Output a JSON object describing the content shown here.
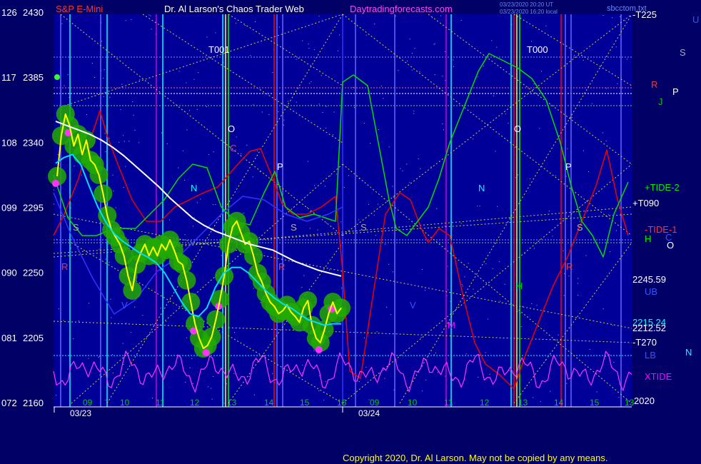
{
  "header": {
    "left_title": "S&P E-Mini",
    "center_title": "Dr. Al Larson's Chaos Trader Web",
    "site": "Daytradingforecasts.com",
    "timestamp_1": "03/23/2020 20:20 UT",
    "timestamp_2": "03/23/2020 16:20 local",
    "right_note": "sbcctom.txt"
  },
  "footer": {
    "copyright": "Copyright 2020, Dr. Al Larson. May not be copied by any means."
  },
  "colors": {
    "background": "#000066",
    "plot_bg": "#000099",
    "price_yellow": "#ffff00",
    "green_bubbles": "#22bb00",
    "magenta": "#ff00ff",
    "cyan": "#00ffff",
    "white": "#ffffff",
    "red": "#ff0000",
    "green_line": "#00ee00",
    "blue": "#3333ff"
  },
  "chart_data": {
    "type": "line",
    "title": "S&P E-Mini",
    "y_axis_left": {
      "ticks": [
        {
          "left": "126",
          "right": "2430"
        },
        {
          "left": "117",
          "right": "2385"
        },
        {
          "left": "108",
          "right": "2340"
        },
        {
          "left": "099",
          "right": "2295"
        },
        {
          "left": "090",
          "right": "2250"
        },
        {
          "left": "081",
          "right": "2205"
        },
        {
          "left": "072",
          "right": "2160"
        }
      ],
      "ylim": [
        2160,
        2430
      ]
    },
    "x_axis": {
      "hour_labels": [
        "09",
        "10",
        "11",
        "12",
        "13",
        "14",
        "15",
        "16",
        "09",
        "10",
        "11",
        "12",
        "13",
        "14",
        "15",
        "13"
      ],
      "date_labels": [
        "03/23",
        "03/24"
      ]
    },
    "right_labels": {
      "t225": "-T225",
      "tide2": "+TIDE-2",
      "t090": "+T090",
      "tide1": "-TIDE-1",
      "h": "H",
      "c": "C",
      "o": "O",
      "v1": "2245.59",
      "ub": "UB",
      "v2": "2215.24",
      "v3": "2212.52",
      "t270": "-T270",
      "lb": "LB",
      "n": "N",
      "xtide": "XTIDE",
      "v4": "2020",
      "u": "U",
      "s": "S",
      "r": "R",
      "p": "P",
      "j": "J"
    },
    "chart_letters": {
      "t001": "T001",
      "t000": "T000",
      "o": "O",
      "c": "C",
      "p": "P",
      "n": "N",
      "s": "S",
      "r": "R",
      "v": "V",
      "m": "M",
      "h": "H"
    },
    "price_series": {
      "name": "price",
      "values": [
        2317,
        2345,
        2360,
        2352,
        2338,
        2346,
        2332,
        2342,
        2328,
        2325,
        2318,
        2305,
        2290,
        2280,
        2275,
        2270,
        2262,
        2248,
        2238,
        2256,
        2264,
        2270,
        2262,
        2268,
        2262,
        2270,
        2266,
        2273,
        2266,
        2258,
        2256,
        2245,
        2230,
        2215,
        2205,
        2198,
        2200,
        2206,
        2218,
        2232,
        2248,
        2270,
        2282,
        2286,
        2278,
        2270,
        2272,
        2262,
        2250,
        2244,
        2236,
        2230,
        2227,
        2222,
        2224,
        2228,
        2223,
        2220,
        2216,
        2226,
        2231,
        2214,
        2205,
        2202,
        2211,
        2222,
        2230,
        2222,
        2226
      ]
    },
    "ma_white": [
      2355,
      2352,
      2349,
      2346,
      2342,
      2337,
      2331,
      2324,
      2317,
      2310,
      2302,
      2295,
      2288,
      2283,
      2279,
      2276,
      2273,
      2270,
      2268,
      2266,
      2262,
      2258,
      2255,
      2252,
      2250,
      2248
    ],
    "ma_cyan": [
      2326,
      2330,
      2332,
      2325,
      2310,
      2296,
      2285,
      2277,
      2272,
      2268,
      2264,
      2261,
      2257,
      2250,
      2240,
      2230,
      2222,
      2220,
      2226,
      2240,
      2250,
      2254,
      2254,
      2250,
      2244,
      2238,
      2233,
      2229,
      2226,
      2222,
      2218,
      2216,
      2214,
      2215,
      2215
    ]
  }
}
